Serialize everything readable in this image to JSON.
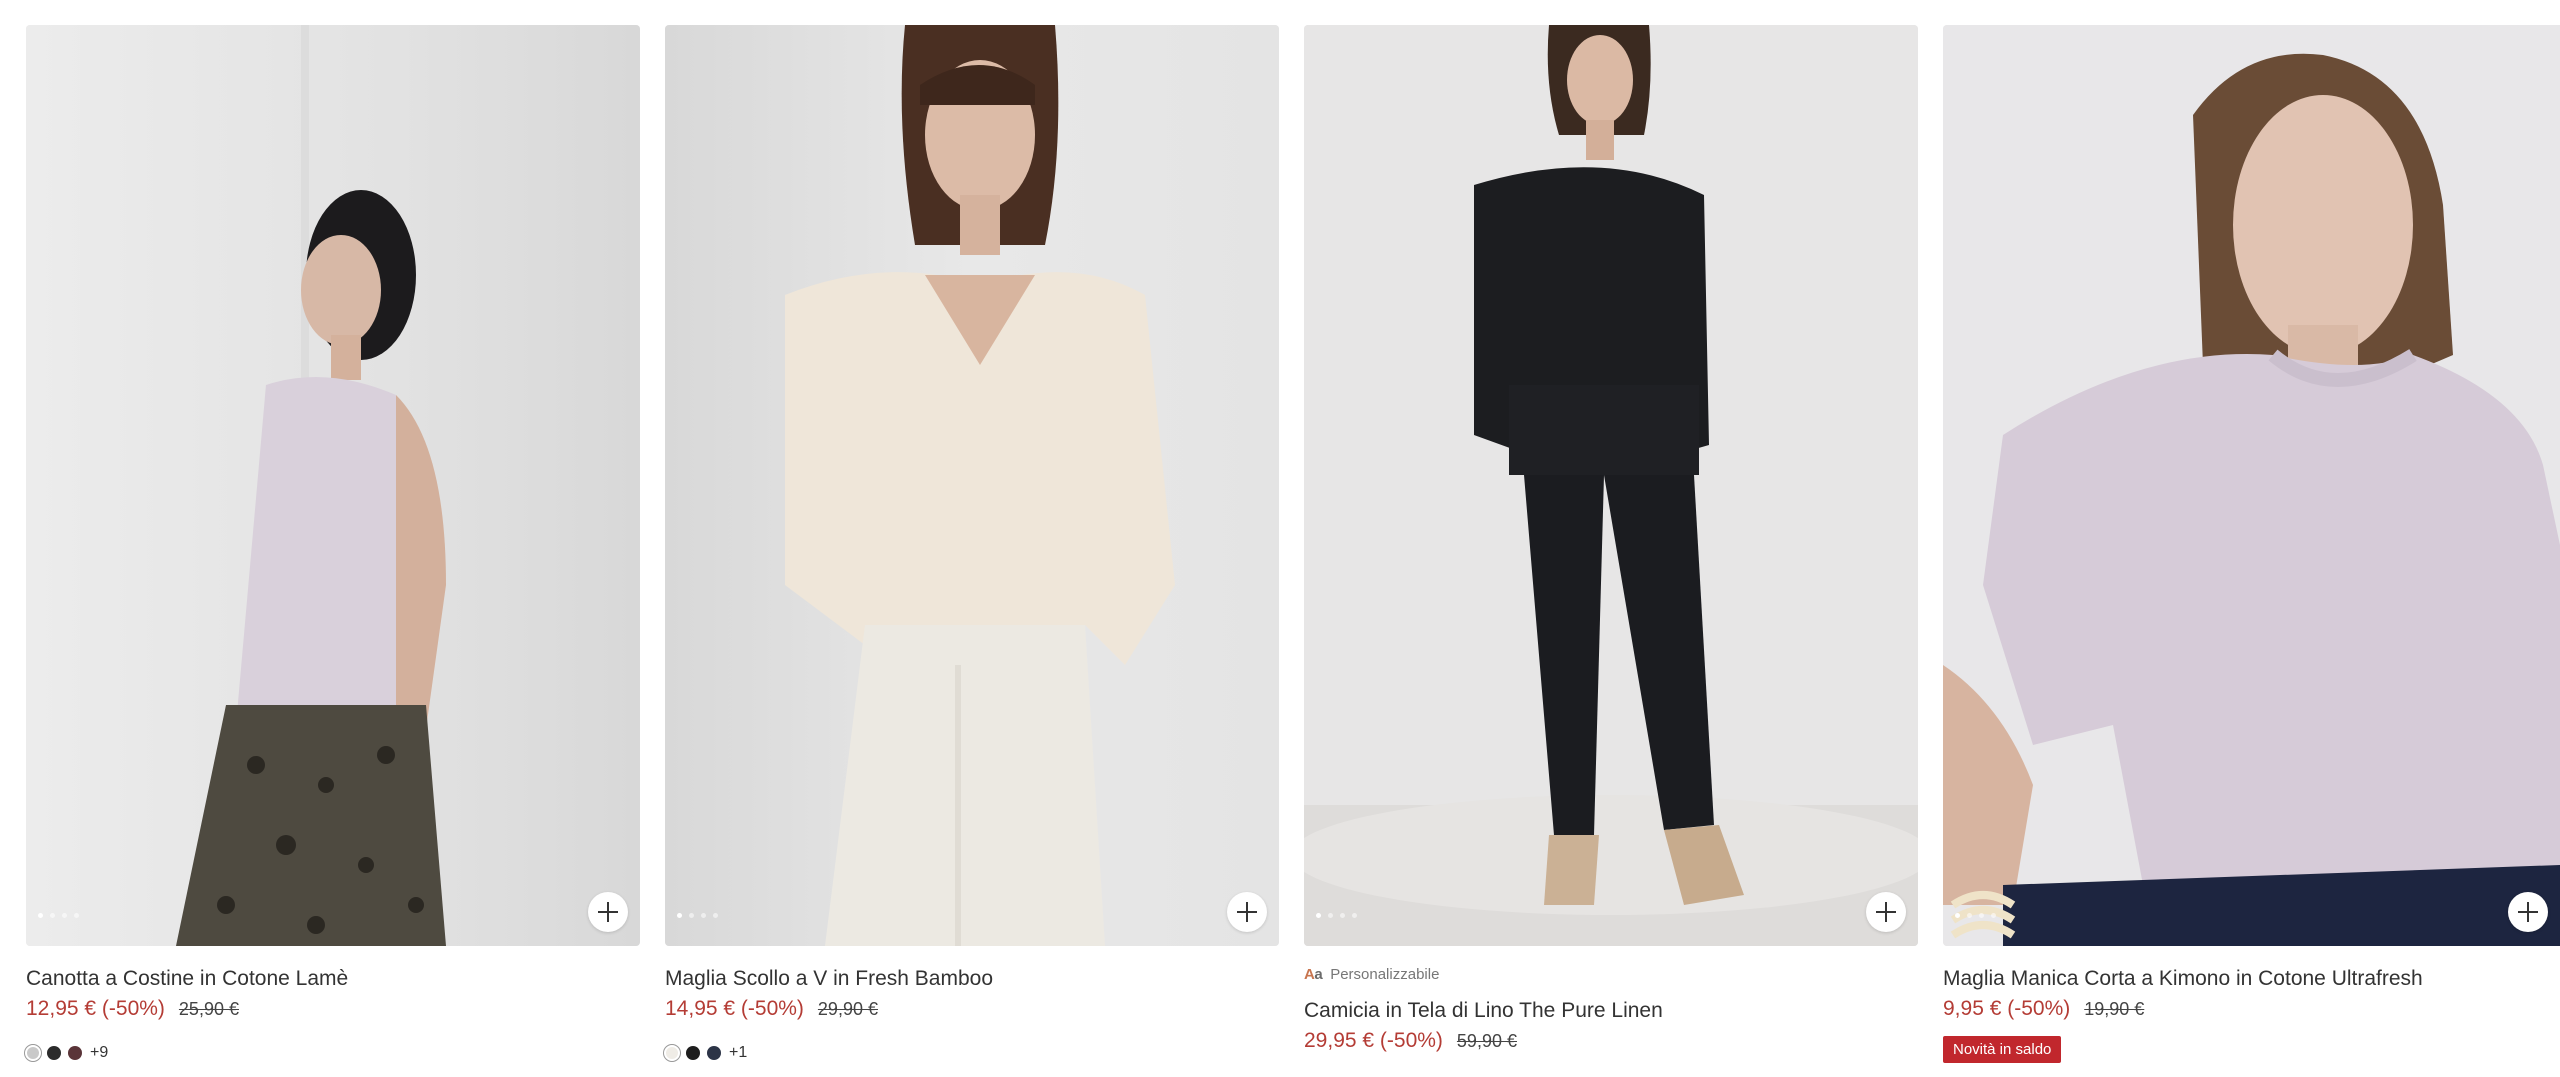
{
  "products": [
    {
      "title": "Canotta a Costine in Cotone Lamè",
      "price": "12,95 € (-50%)",
      "old_price": "25,90 €",
      "image_icon": "model-photo",
      "more_colors": "+9",
      "swatches": [
        "#c9c9c9",
        "#2b2b2b",
        "#5a3438"
      ],
      "carousel_dots": 4
    },
    {
      "title": "Maglia Scollo a V in Fresh Bamboo",
      "price": "14,95 € (-50%)",
      "old_price": "29,90 €",
      "image_icon": "model-photo",
      "more_colors": "+1",
      "swatches": [
        "#efece6",
        "#1e1e1e",
        "#2c3447"
      ],
      "carousel_dots": 4
    },
    {
      "title": "Camicia in Tela di Lino The Pure Linen",
      "price": "29,95 € (-50%)",
      "old_price": "59,90 €",
      "image_icon": "model-photo",
      "custom_tag": "Personalizzabile",
      "custom_icon": "Aa",
      "carousel_dots": 4
    },
    {
      "title": "Maglia Manica Corta a Kimono in Cotone Ultrafresh",
      "price": "9,95 € (-50%)",
      "old_price": "19,90 €",
      "image_icon": "model-photo",
      "badge": "Novità in saldo",
      "carousel_dots": 4
    }
  ],
  "colors": {
    "sale_price": "#b43c35",
    "badge_bg": "#c1272d",
    "photo_bg": "#e9e8e8"
  }
}
